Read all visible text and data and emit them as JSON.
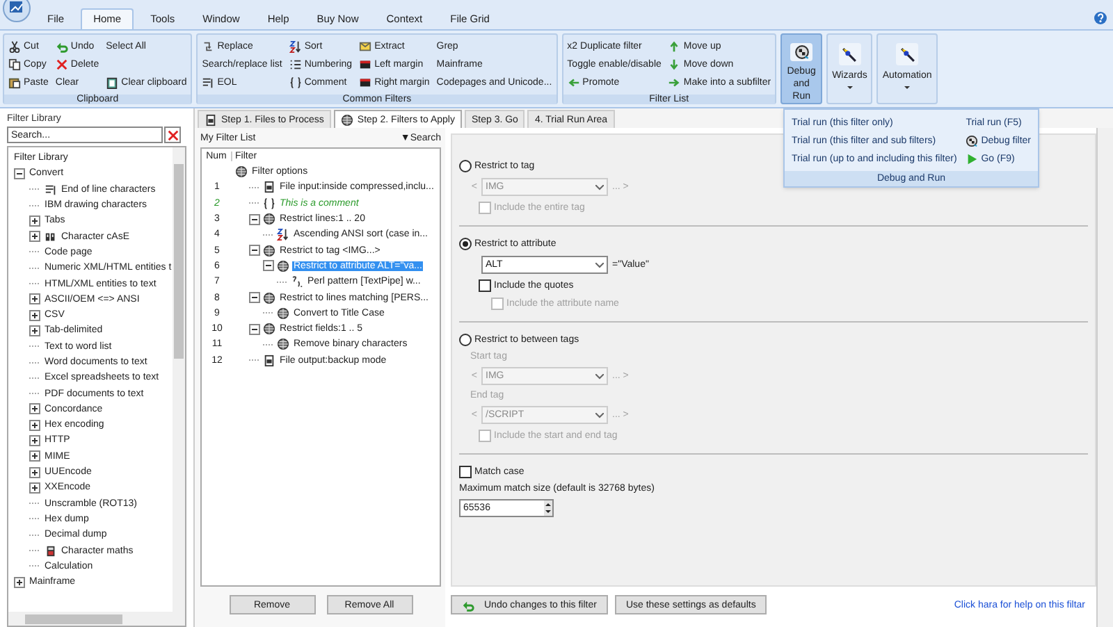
{
  "menu_tabs": [
    {
      "label": "File",
      "selected": false
    },
    {
      "label": "Home",
      "selected": true
    },
    {
      "label": "Tools",
      "selected": false
    },
    {
      "label": "Window",
      "selected": false
    },
    {
      "label": "Help",
      "selected": false
    },
    {
      "label": "Buy Now",
      "selected": false
    },
    {
      "label": "Context",
      "selected": false
    },
    {
      "label": "File Grid",
      "selected": false
    }
  ],
  "ribbon_groups": [
    {
      "title": "Clipboard",
      "columns": [
        [
          "Cut",
          "Copy",
          "Paste"
        ],
        [
          "Undo",
          "Delete",
          "Clear"
        ],
        [
          "Select All",
          "Clear clipboard"
        ]
      ]
    },
    {
      "title": "Common Filters",
      "columns": [
        [
          "Replace",
          "Search/replace list",
          "EOL"
        ],
        [
          "Sort",
          "Numbering",
          "Comment"
        ],
        [
          "Extract",
          "Left margin",
          "Right margin"
        ],
        [
          "Grep",
          "Mainframe",
          "Codepages and Unicode..."
        ]
      ]
    },
    {
      "title": "Filter List",
      "columns": [
        [
          "x2 Duplicate filter",
          "Toggle enable/disable",
          "Promote"
        ],
        [
          "Move up",
          "Move down",
          "Make into a subfilter"
        ]
      ]
    }
  ],
  "large_buttons": [
    {
      "label": "Debug and Run",
      "selected": true,
      "dropdown": false
    },
    {
      "label": "Wizards",
      "selected": false,
      "dropdown": true
    },
    {
      "label": "Automation",
      "selected": false,
      "dropdown": true
    }
  ],
  "dropdown_menu": {
    "columns": [
      [
        "Trial run (this filter only)",
        "Trial run (this filter and sub filters)",
        "Trial run (up to and including this filter)"
      ],
      [
        "Trial run (F5)",
        "Debug filter",
        "Go (F9)"
      ]
    ],
    "footer": "Debug and Run"
  },
  "filter_library": {
    "title": "Filter Library",
    "search": {
      "placeholder": "Search..."
    },
    "root": "Filter Library",
    "tree": [
      {
        "label": "Convert",
        "expanded": true,
        "children": [
          {
            "label": "End of line characters"
          },
          {
            "label": "IBM drawing characters"
          },
          {
            "label": "Tabs",
            "expanded": false
          },
          {
            "label": "Character cAsE",
            "expanded": false
          },
          {
            "label": "Code page"
          },
          {
            "label": "Numeric XML/HTML entities t"
          },
          {
            "label": "HTML/XML entities to text"
          },
          {
            "label": "ASCII/OEM <=> ANSI",
            "expanded": false
          },
          {
            "label": "CSV",
            "expanded": false
          },
          {
            "label": "Tab-delimited",
            "expanded": false
          },
          {
            "label": "Text to word list"
          },
          {
            "label": "Word documents to text"
          },
          {
            "label": "Excel spreadsheets to text"
          },
          {
            "label": "PDF documents to text"
          },
          {
            "label": "Concordance",
            "expanded": false
          },
          {
            "label": "Hex encoding",
            "expanded": false
          },
          {
            "label": "HTTP",
            "expanded": false
          },
          {
            "label": "MIME",
            "expanded": false
          },
          {
            "label": "UUEncode",
            "expanded": false
          },
          {
            "label": "XXEncode",
            "expanded": false
          },
          {
            "label": "Unscramble (ROT13)"
          },
          {
            "label": "Hex dump"
          },
          {
            "label": "Decimal dump"
          },
          {
            "label": "Character maths"
          },
          {
            "label": "Calculation"
          }
        ]
      },
      {
        "label": "Mainframe",
        "expanded": false
      }
    ]
  },
  "step_tabs": [
    {
      "label": "Step 1. Files to Process",
      "selected": false
    },
    {
      "label": "Step 2. Filters to Apply",
      "selected": true
    },
    {
      "label": "Step 3. Go",
      "selected": false
    },
    {
      "label": "4. Trial Run Area",
      "selected": false
    }
  ],
  "filter_list": {
    "title": "My Filter List",
    "search": "▼Search",
    "columns": [
      "Num",
      "Filter"
    ],
    "tree": [
      {
        "label": "Filter options",
        "kind": "filter",
        "children": [
          {
            "num": "1",
            "label": "File input:inside compressed,inclu...",
            "kind": "file"
          },
          {
            "num": "2",
            "label": "This is a comment",
            "kind": "comment"
          },
          {
            "num": "3",
            "label": "Restrict lines:1 .. 20",
            "kind": "filter",
            "expanded": true,
            "children": [
              {
                "num": "4",
                "label": "Ascending ANSI sort (case in...",
                "kind": "sort"
              }
            ]
          },
          {
            "num": "5",
            "label": "Restrict to tag <IMG...>",
            "kind": "filter",
            "expanded": true,
            "children": [
              {
                "num": "6",
                "label": "Restrict to attribute ALT=\"va...",
                "kind": "filter",
                "expanded": true,
                "selected": true,
                "children": [
                  {
                    "num": "7",
                    "label": "Perl pattern [TextPipe] w...",
                    "kind": "pattern"
                  }
                ]
              }
            ]
          },
          {
            "num": "8",
            "label": "Restrict to lines matching [PERS...",
            "kind": "filter",
            "expanded": true,
            "children": [
              {
                "num": "9",
                "label": "Convert to Title Case",
                "kind": "filter"
              }
            ]
          },
          {
            "num": "10",
            "label": "Restrict fields:1 .. 5",
            "kind": "filter",
            "expanded": true,
            "children": [
              {
                "num": "11",
                "label": "Remove binary characters",
                "kind": "filter"
              }
            ]
          },
          {
            "num": "12",
            "label": "File output:backup mode",
            "kind": "file"
          }
        ]
      }
    ],
    "buttons": [
      "Remove",
      "Remove All"
    ]
  },
  "options": [
    {
      "kind": "radio",
      "label": "Restrict to tag",
      "selected": false
    },
    {
      "kind": "combo",
      "prefix": "<",
      "value": "IMG",
      "suffix": "... >",
      "disabled": true
    },
    {
      "kind": "checkbox",
      "label": "Include the entire tag",
      "checked": false,
      "disabled": true
    },
    {
      "kind": "rule"
    },
    {
      "kind": "radio",
      "label": "Restrict to attribute",
      "selected": true
    },
    {
      "kind": "combo",
      "value": "ALT",
      "suffix": "=\"Value\"",
      "disabled": false
    },
    {
      "kind": "checkbox",
      "label": "Include the quotes",
      "checked": false,
      "disabled": false
    },
    {
      "kind": "subcheckbox",
      "label": "Include the attribute name",
      "checked": false,
      "disabled": true
    },
    {
      "kind": "rule"
    },
    {
      "kind": "radio",
      "label": "Restrict to between tags",
      "selected": false
    },
    {
      "kind": "caption",
      "label": "Start tag",
      "disabled": true
    },
    {
      "kind": "combo",
      "prefix": "<",
      "value": "IMG",
      "suffix": "... >",
      "disabled": true
    },
    {
      "kind": "caption",
      "label": "End tag",
      "disabled": true
    },
    {
      "kind": "combo",
      "prefix": "<",
      "value": "/SCRIPT",
      "suffix": "... >",
      "disabled": true
    },
    {
      "kind": "checkbox",
      "label": "Include the start and end tag",
      "checked": false,
      "disabled": true
    },
    {
      "kind": "rule"
    },
    {
      "kind": "checkbox",
      "label": "Match case",
      "checked": false,
      "disabled": false
    },
    {
      "kind": "caption",
      "label": "Maximum match size (default is 32768 bytes)",
      "disabled": false
    },
    {
      "kind": "spin",
      "value": "65536"
    }
  ],
  "bottom_buttons": [
    "Undo changes to this filter",
    "Use these settings as defaults"
  ],
  "help_link": "Click hara for help on this filtar"
}
